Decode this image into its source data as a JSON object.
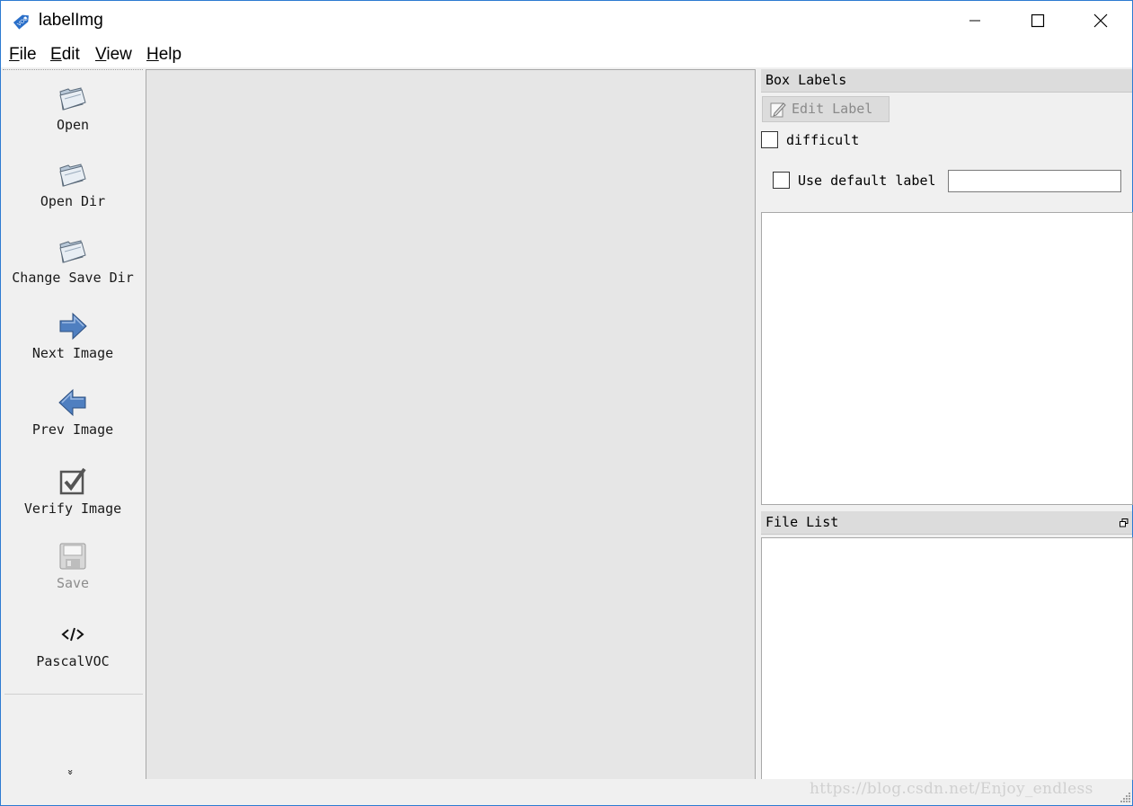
{
  "window": {
    "title": "labelImg",
    "app_icon_text": "VOC"
  },
  "menu": {
    "items": [
      {
        "label": "File",
        "mnemonic": "F",
        "rest": "ile"
      },
      {
        "label": "Edit",
        "mnemonic": "E",
        "rest": "dit"
      },
      {
        "label": "View",
        "mnemonic": "V",
        "rest": "iew"
      },
      {
        "label": "Help",
        "mnemonic": "H",
        "rest": "elp"
      }
    ]
  },
  "toolbar": {
    "tools": [
      {
        "label": "Open",
        "icon": "open-folder-icon",
        "enabled": true
      },
      {
        "label": "Open Dir",
        "icon": "open-folder-icon",
        "enabled": true
      },
      {
        "label": "Change Save Dir",
        "icon": "open-folder-icon",
        "enabled": true
      },
      {
        "label": "Next Image",
        "icon": "arrow-right-icon",
        "enabled": true
      },
      {
        "label": "Prev Image",
        "icon": "arrow-left-icon",
        "enabled": true
      },
      {
        "label": "Verify Image",
        "icon": "checkbox-verify-icon",
        "enabled": true
      },
      {
        "label": "Save",
        "icon": "save-disk-icon",
        "enabled": false
      },
      {
        "label": "PascalVOC",
        "icon": "code-tag-icon",
        "enabled": true
      }
    ],
    "extension_glyph": "»"
  },
  "box_labels": {
    "title": "Box Labels",
    "edit_label_button": "Edit Label",
    "difficult_label": "difficult",
    "difficult_checked": false,
    "use_default_label": "Use default label",
    "use_default_checked": false,
    "default_label_value": ""
  },
  "file_list": {
    "title": "File List"
  },
  "status": {
    "watermark": "https://blog.csdn.net/Enjoy_endless"
  },
  "colors": {
    "window_border": "#2d7bd1",
    "canvas_bg": "#e6e6e6",
    "dock_title_bg": "#dcdcdc",
    "chrome_bg": "#f0f0f0"
  }
}
